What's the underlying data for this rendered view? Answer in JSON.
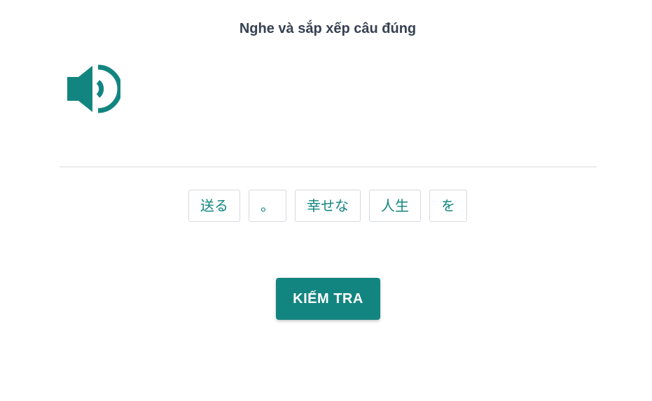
{
  "exercise": {
    "instruction": "Nghe và sắp xếp câu đúng",
    "audio_icon": "speaker-volume-icon",
    "accent_color": "#138580"
  },
  "word_bank": {
    "chips": [
      {
        "text": "送る"
      },
      {
        "text": "。"
      },
      {
        "text": "幸せな"
      },
      {
        "text": "人生"
      },
      {
        "text": "を"
      }
    ]
  },
  "actions": {
    "check_label": "KIẾM TRA"
  }
}
